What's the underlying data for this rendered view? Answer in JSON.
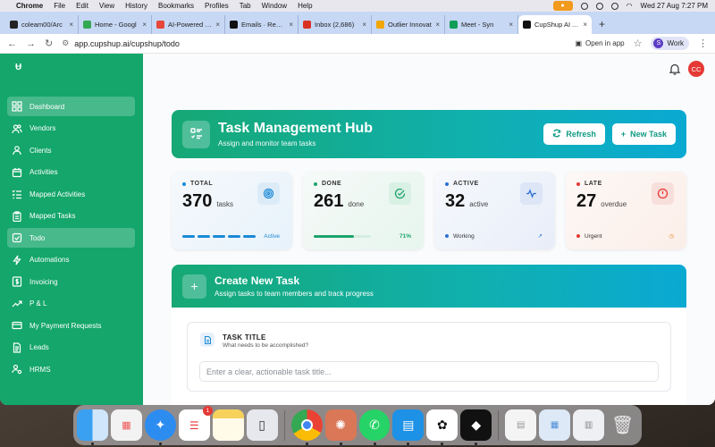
{
  "menubar": {
    "apple": "",
    "items": [
      "Chrome",
      "File",
      "Edit",
      "View",
      "History",
      "Bookmarks",
      "Profiles",
      "Tab",
      "Window",
      "Help"
    ],
    "datetime": "Wed 27 Aug  7:27 PM"
  },
  "tabs": [
    {
      "label": "coleam00/Arc",
      "color": "#222222"
    },
    {
      "label": "Home - Googl",
      "color": "#34a853"
    },
    {
      "label": "AI-Powered Co",
      "color": "#e7463a"
    },
    {
      "label": "Emails · Resen",
      "color": "#111111"
    },
    {
      "label": "Inbox (2,686)",
      "color": "#d93025"
    },
    {
      "label": "Outlier Innovat",
      "color": "#f2a600"
    },
    {
      "label": "Meet - Syn",
      "color": "#0f9d58"
    },
    {
      "label": "CupShup AI Ag",
      "color": "#111111"
    }
  ],
  "toolbar": {
    "url": "app.cupshup.ai/cupshup/todo",
    "open_in_app": "Open in app",
    "profile_initial": "S",
    "profile": "Work"
  },
  "app": {
    "logo": "Ʉ",
    "avatar": "CC"
  },
  "sidebar": {
    "items": [
      {
        "label": "Dashboard",
        "icon": "dashboard-icon"
      },
      {
        "label": "Vendors",
        "icon": "users-icon"
      },
      {
        "label": "Clients",
        "icon": "user-icon"
      },
      {
        "label": "Activities",
        "icon": "calendar-icon"
      },
      {
        "label": "Mapped Activities",
        "icon": "list-check-icon"
      },
      {
        "label": "Mapped Tasks",
        "icon": "clipboard-icon"
      },
      {
        "label": "Todo",
        "icon": "check-square-icon"
      },
      {
        "label": "Automations",
        "icon": "lightning-icon"
      },
      {
        "label": "Invoicing",
        "icon": "dollar-icon"
      },
      {
        "label": "P & L",
        "icon": "trend-icon"
      },
      {
        "label": "My Payment Requests",
        "icon": "card-icon"
      },
      {
        "label": "Leads",
        "icon": "document-icon"
      },
      {
        "label": "HRMS",
        "icon": "user-network-icon"
      }
    ]
  },
  "hero": {
    "title": "Task Management Hub",
    "subtitle": "Assign and monitor team tasks",
    "refresh_label": "Refresh",
    "new_task_label": "New Task"
  },
  "stats": [
    {
      "label": "TOTAL",
      "value": "370",
      "unit": "tasks",
      "footer": "Active",
      "color": "#1a8ad6"
    },
    {
      "label": "DONE",
      "value": "261",
      "unit": "done",
      "footer": "71%",
      "progress": 0.71,
      "color": "#1da36b"
    },
    {
      "label": "ACTIVE",
      "value": "32",
      "unit": "active",
      "footer": "Working",
      "color": "#2b6fd6"
    },
    {
      "label": "LATE",
      "value": "27",
      "unit": "overdue",
      "footer": "Urgent",
      "color": "#e53935"
    }
  ],
  "create_task": {
    "title": "Create New Task",
    "subtitle": "Assign tasks to team members and track progress",
    "field_title": "TASK TITLE",
    "field_hint": "What needs to be accomplished?",
    "field_placeholder": "Enter a clear, actionable task title..."
  },
  "dock": {
    "reminders_badge": "1"
  }
}
